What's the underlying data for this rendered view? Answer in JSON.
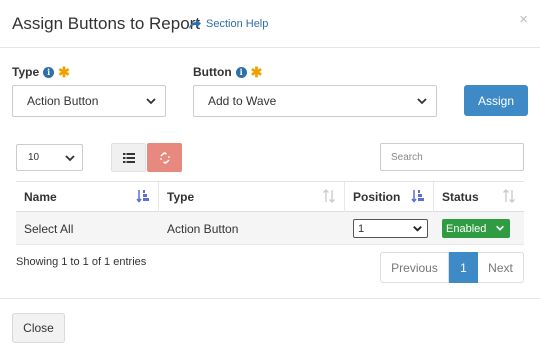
{
  "modal": {
    "title": "Assign Buttons to Report",
    "help_label": "Section Help",
    "close_glyph": "×"
  },
  "form": {
    "type_label": "Type",
    "type_value": "Action Button",
    "button_label": "Button",
    "button_value": "Add to Wave",
    "required_mark": "✱",
    "info_glyph": "i",
    "assign_label": "Assign"
  },
  "table_controls": {
    "page_size": "10",
    "search_placeholder": "Search"
  },
  "table": {
    "columns": [
      "Name",
      "Type",
      "Position",
      "Status"
    ],
    "rows": [
      {
        "name": "Select All",
        "type": "Action Button",
        "position": "1",
        "status": "Enabled"
      }
    ]
  },
  "summary": "Showing 1 to 1 of 1 entries",
  "pagination": {
    "previous": "Previous",
    "current": "1",
    "next": "Next"
  },
  "footer": {
    "close_label": "Close"
  },
  "colors": {
    "primary": "#3d8ac7",
    "warning_star": "#f0a100",
    "unlink_button": "#e7897f",
    "status_enabled": "#2f9c43",
    "link": "#2e6fa8"
  },
  "icons": {
    "help": "share-arrow-icon",
    "info": "info-circle-icon",
    "list_view": "list-icon",
    "unassign": "unlink-icon",
    "sort_active": "sort-amount-icon",
    "sort_inactive": "sort-arrows-icon"
  }
}
